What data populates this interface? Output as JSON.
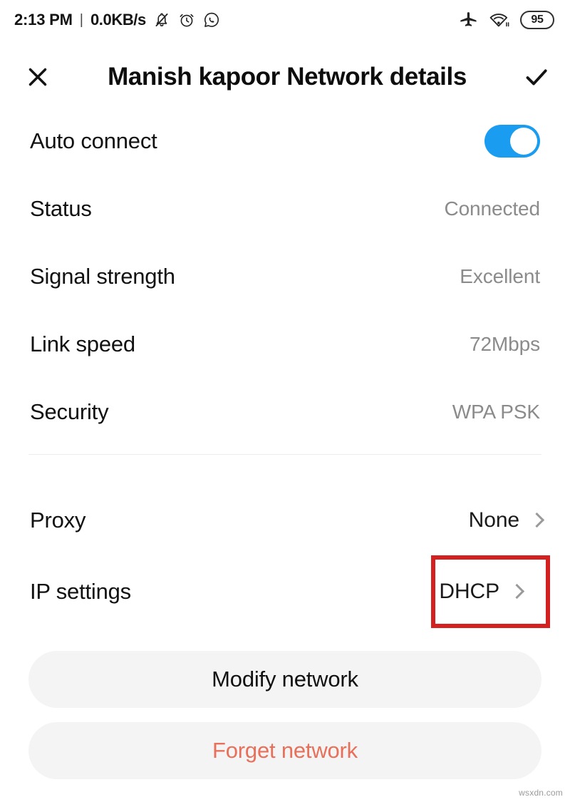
{
  "status_bar": {
    "clock": "2:13 PM",
    "separator": "|",
    "network_speed": "0.0KB/s",
    "left_icons": [
      "notification-muted-icon",
      "alarm-clock-icon",
      "whatsapp-icon"
    ],
    "right_icons": [
      "airplane-mode-icon",
      "wifi-icon"
    ],
    "battery_level": "95"
  },
  "app_bar": {
    "close_label": "close-icon",
    "title": "Manish kapoor Network details",
    "confirm_label": "check-icon"
  },
  "details": {
    "auto_connect": {
      "label": "Auto connect",
      "toggle_state": "on"
    },
    "rows": [
      {
        "label": "Status",
        "value": "Connected"
      },
      {
        "label": "Signal strength",
        "value": "Excellent"
      },
      {
        "label": "Link speed",
        "value": "72Mbps"
      },
      {
        "label": "Security",
        "value": "WPA PSK"
      }
    ],
    "nav_rows": [
      {
        "label": "Proxy",
        "value": "None",
        "highlighted": false
      },
      {
        "label": "IP settings",
        "value": "DHCP",
        "highlighted": true
      }
    ]
  },
  "actions": {
    "modify_label": "Modify network",
    "forget_label": "Forget network"
  },
  "watermark": "wsxdn.com",
  "colors": {
    "toggle_on": "#1a9cf0",
    "highlight_border": "#d32020",
    "danger_text": "#e8705a",
    "value_text": "#8b8b8b",
    "button_bg": "#f4f4f4"
  }
}
